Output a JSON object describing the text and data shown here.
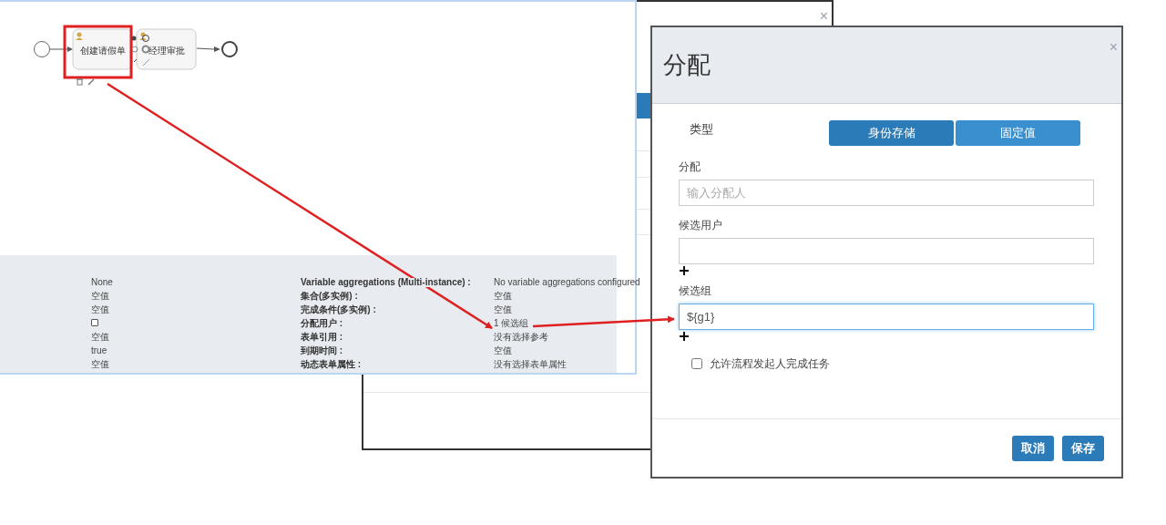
{
  "back_window": {
    "close": "×"
  },
  "diagram": {
    "tasks": [
      {
        "label": "创建请假单",
        "selected": true
      },
      {
        "label": "经理审批",
        "selected": false
      }
    ]
  },
  "properties": {
    "rows": [
      {
        "kind": "text",
        "value_left": "None",
        "label": "Variable aggregations (Multi-instance) :",
        "value_right": "No variable aggregations configured"
      },
      {
        "kind": "text",
        "value_left": "空值",
        "label": "集合(多实例) :",
        "value_right": "空值"
      },
      {
        "kind": "text",
        "value_left": "空值",
        "label": "完成条件(多实例) :",
        "value_right": "空值"
      },
      {
        "kind": "checkbox",
        "checked": false,
        "label": "分配用户 :",
        "value_right": "1 候选组"
      },
      {
        "kind": "text",
        "value_left": "空值",
        "label": "表单引用 :",
        "value_right": "没有选择参考"
      },
      {
        "kind": "text",
        "value_left": "true",
        "label": "到期时间 :",
        "value_right": "空值"
      },
      {
        "kind": "text",
        "value_left": "空值",
        "label": "动态表单属性 :",
        "value_right": "没有选择表单属性"
      }
    ]
  },
  "dialog": {
    "title": "分配",
    "close": "×",
    "type_label": "类型",
    "type_options": [
      {
        "label": "身份存储",
        "selected": true
      },
      {
        "label": "固定值",
        "selected": false
      }
    ],
    "fields": [
      {
        "label": "分配",
        "placeholder": "输入分配人",
        "focused": false,
        "addable": false
      },
      {
        "label": "候选用户",
        "focused": false,
        "addable": true
      },
      {
        "label": "候选组",
        "value": "${g1}",
        "focused": true,
        "addable": true
      }
    ],
    "checkbox": {
      "label": "允许流程发起人完成任务",
      "checked": false
    },
    "buttons": [
      "取消",
      "保存"
    ]
  }
}
